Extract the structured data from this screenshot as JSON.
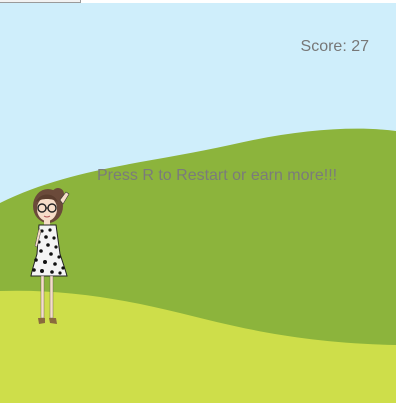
{
  "game": {
    "score_text": "Score: 27",
    "message": "Press R to Restart or earn more!!!",
    "colors": {
      "sky": "#cfeefb",
      "far_hill": "#8cb43c",
      "near_hill": "#cede4a",
      "text": "#777777"
    },
    "icons": {
      "player": "girl-character-icon"
    }
  }
}
